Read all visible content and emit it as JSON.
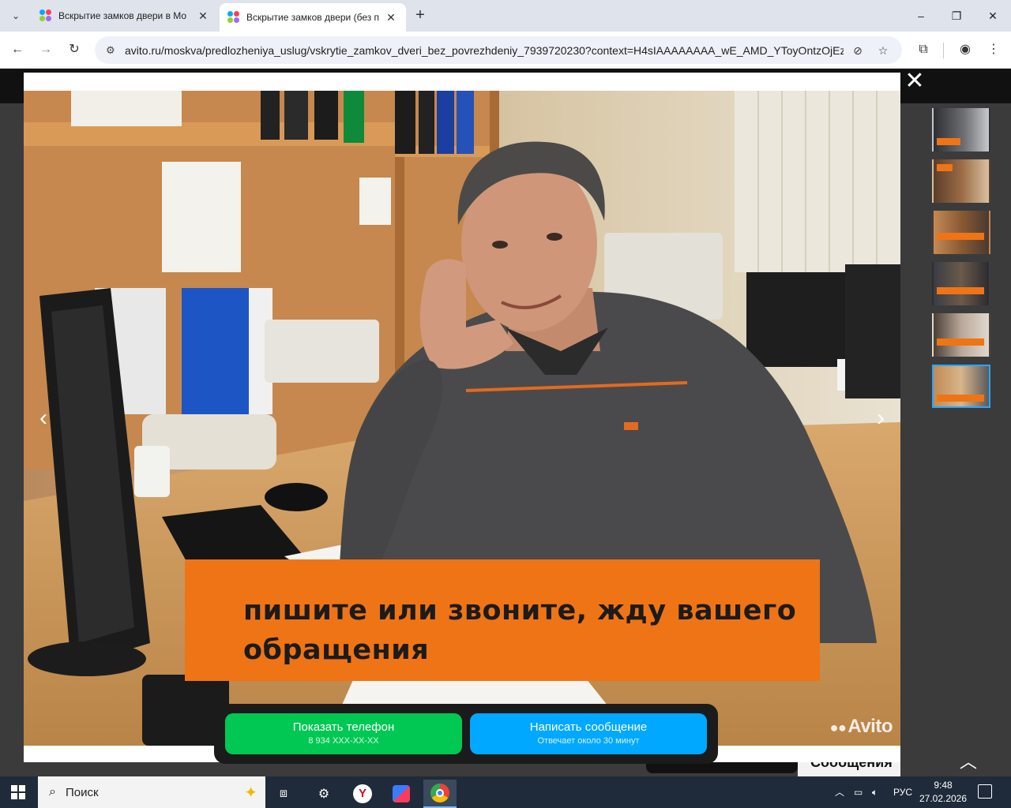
{
  "browser": {
    "tabs": [
      {
        "title": "Вскрытие замков двери в Мо",
        "active": false
      },
      {
        "title": "Вскрытие замков двери (без п",
        "active": true
      }
    ],
    "new_tab": "+",
    "window_controls": {
      "minimize": "–",
      "restore": "❐",
      "close": "✕"
    },
    "url_host": "avito.ru",
    "url_path": "/moskva/predlozheniya_uslug/vskrytie_zamkov_dveri_bez_povrezhdeniy_7939720230?context=H4sIAAAAAAAA_wE_AMD_YToyOntzOjEzOi...",
    "icons": {
      "back": "back-arrow-icon",
      "forward": "forward-arrow-icon",
      "reload": "reload-icon",
      "site_info": "tune-icon",
      "tracking": "eye-off-icon",
      "bookmark": "star-icon",
      "extensions": "puzzle-icon",
      "profile": "profile-icon",
      "menu": "kebab-menu-icon"
    }
  },
  "viewer": {
    "caption": "пишите или звоните, жду вашего обращения",
    "watermark": "Avito",
    "thumbnails_count": 6,
    "selected_thumbnail": 6,
    "prev_label": "‹",
    "next_label": "›",
    "close_label": "✕"
  },
  "cta": {
    "phone_title": "Показать телефон",
    "phone_sub": "8 934 XXX-XX-XX",
    "message_title": "Написать сообщение",
    "message_sub": "Отвечает около 30 минут"
  },
  "background_page": {
    "peek_text": "Сообщения"
  },
  "taskbar": {
    "search_placeholder": "Поиск",
    "lang": "РУС",
    "time": "9:48",
    "date": "27.02.2026"
  },
  "colors": {
    "caption_bg": "#ef7416",
    "phone_btn": "#00c853",
    "message_btn": "#00a8ff",
    "thumb_selected": "#2aa5ff"
  }
}
